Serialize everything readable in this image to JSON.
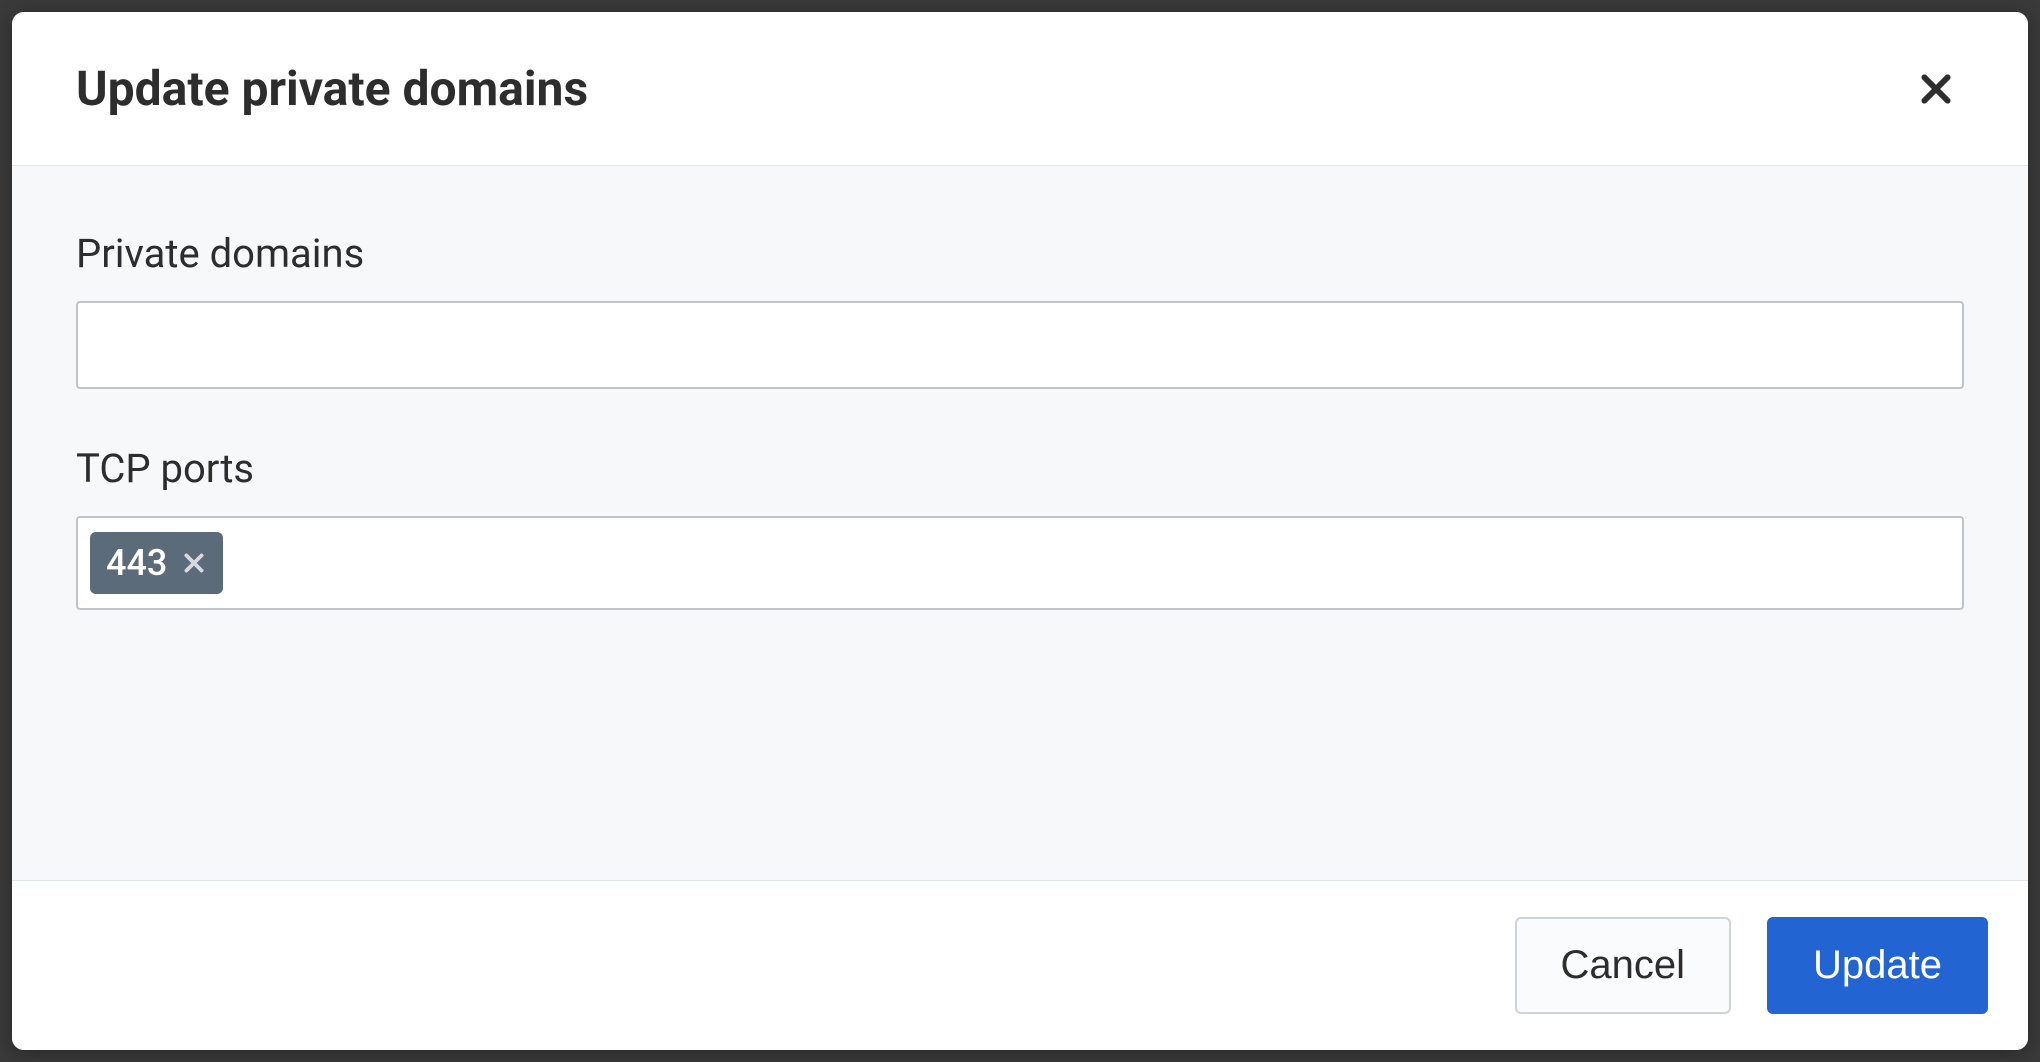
{
  "modal": {
    "title": "Update private domains",
    "body": {
      "private_domains": {
        "label": "Private domains",
        "value": ""
      },
      "tcp_ports": {
        "label": "TCP ports",
        "tags": [
          {
            "value": "443"
          }
        ]
      }
    },
    "footer": {
      "cancel_label": "Cancel",
      "update_label": "Update"
    }
  }
}
